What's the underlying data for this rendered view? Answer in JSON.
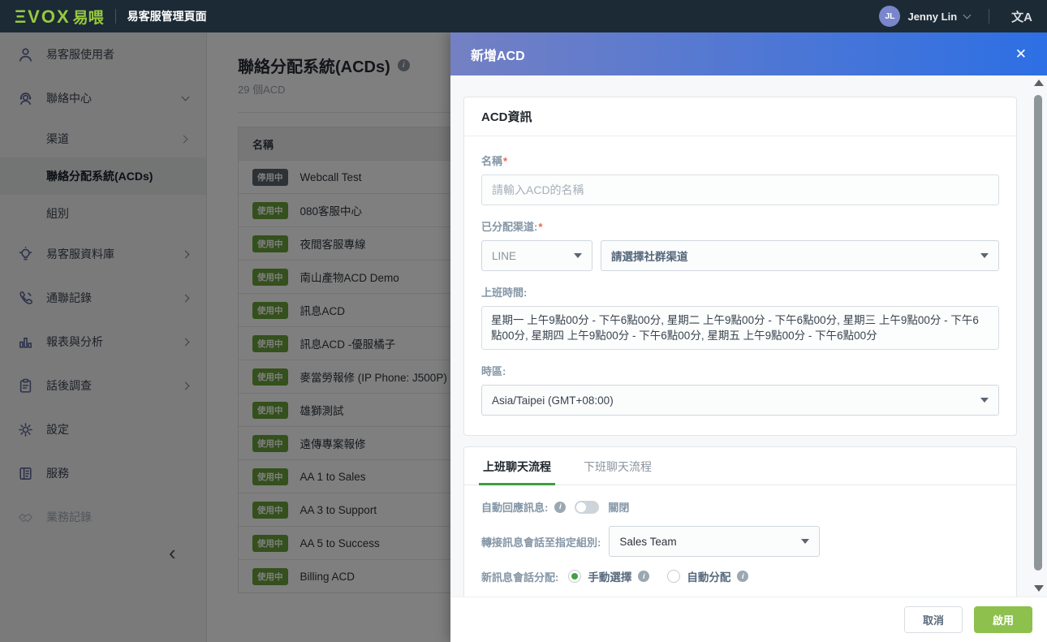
{
  "topbar": {
    "logo_text": "ΞVOX",
    "logo_suffix": "易喂",
    "app_title": "易客服管理頁面",
    "user": {
      "initials": "JL",
      "name": "Jenny Lin"
    },
    "language_icon_glyph": "文A"
  },
  "sidebar": {
    "items": [
      {
        "label": "易客服使用者"
      },
      {
        "label": "聯絡中心"
      },
      {
        "label": "渠道"
      },
      {
        "label": "聯絡分配系統(ACDs)"
      },
      {
        "label": "組別"
      },
      {
        "label": "易客服資料庫"
      },
      {
        "label": "通聯記錄"
      },
      {
        "label": "報表與分析"
      },
      {
        "label": "話後調查"
      },
      {
        "label": "設定"
      },
      {
        "label": "服務"
      },
      {
        "label": "業務記錄"
      }
    ],
    "collapse_glyph": "‹"
  },
  "main": {
    "title": "聯絡分配系統(ACDs)",
    "subtitle": "29 個ACD",
    "table": {
      "name_header": "名稱",
      "rows": [
        {
          "status": "停用中",
          "name": "Webcall Test"
        },
        {
          "status": "使用中",
          "name": "080客服中心"
        },
        {
          "status": "使用中",
          "name": "夜間客服專線"
        },
        {
          "status": "使用中",
          "name": "南山產物ACD Demo"
        },
        {
          "status": "使用中",
          "name": "訊息ACD"
        },
        {
          "status": "使用中",
          "name": "訊息ACD -優服橘子"
        },
        {
          "status": "使用中",
          "name": "麥當勞報修 (IP Phone: J500P)"
        },
        {
          "status": "使用中",
          "name": "雄獅測試"
        },
        {
          "status": "使用中",
          "name": "遠傳專案報修"
        },
        {
          "status": "使用中",
          "name": "AA 1 to Sales"
        },
        {
          "status": "使用中",
          "name": "AA 3 to Support"
        },
        {
          "status": "使用中",
          "name": "AA 5 to Success"
        },
        {
          "status": "使用中",
          "name": "Billing ACD"
        }
      ]
    }
  },
  "modal": {
    "title": "新增ACD",
    "close_glyph": "✕",
    "acd_info": {
      "section_title": "ACD資訊",
      "name_label": "名稱",
      "name_placeholder": "請輸入ACD的名稱",
      "channel_label": "已分配渠道:",
      "channel_type_value": "LINE",
      "channel_select_placeholder": "請選擇社群渠道",
      "hours_label": "上班時間:",
      "hours_value": "星期一 上午9點00分 - 下午6點00分, 星期二 上午9點00分 - 下午6點00分, 星期三 上午9點00分 - 下午6點00分, 星期四 上午9點00分 - 下午6點00分, 星期五 上午9點00分 - 下午6點00分",
      "timezone_label": "時區:",
      "timezone_value": "Asia/Taipei (GMT+08:00)"
    },
    "flow": {
      "tab_onduty": "上班聊天流程",
      "tab_offduty": "下班聊天流程",
      "auto_reply_label": "自動回應訊息:",
      "auto_reply_state": "關閉",
      "transfer_label": "轉接訊息會話至指定組別:",
      "transfer_value": "Sales Team",
      "assign_label": "新訊息會話分配:",
      "assign_option_manual": "手動選擇",
      "assign_option_auto": "自動分配"
    },
    "footer": {
      "cancel_label": "取消",
      "submit_label": "啟用"
    }
  },
  "colors": {
    "topbar_bg": "#1c2a35",
    "logo_green": "#97c93e",
    "header_gradient_start": "#7480c3",
    "header_gradient_end": "#2d6fe4",
    "badge_active": "#69a13b",
    "badge_inactive": "#5a646d",
    "tab_underline": "#3f9e3f",
    "radio_selected": "#43a047",
    "primary_button": "#8ec04e"
  }
}
